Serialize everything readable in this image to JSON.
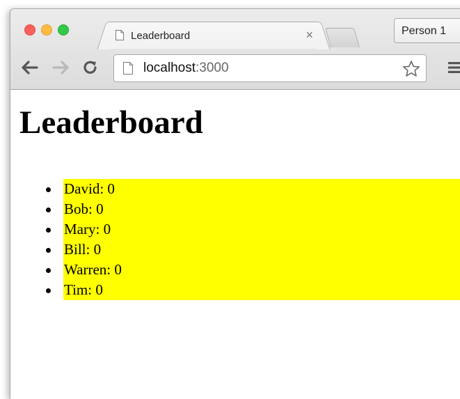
{
  "browser": {
    "tab_title": "Leaderboard",
    "tab_close": "×",
    "profile_button": "Person 1",
    "url_host": "localhost",
    "url_port": ":3000"
  },
  "page": {
    "heading": "Leaderboard",
    "players": [
      {
        "name": "David",
        "score": 0,
        "label": "David: 0"
      },
      {
        "name": "Bob",
        "score": 0,
        "label": "Bob: 0"
      },
      {
        "name": "Mary",
        "score": 0,
        "label": "Mary: 0"
      },
      {
        "name": "Bill",
        "score": 0,
        "label": "Bill: 0"
      },
      {
        "name": "Warren",
        "score": 0,
        "label": "Warren: 0"
      },
      {
        "name": "Tim",
        "score": 0,
        "label": "Tim: 0"
      }
    ]
  },
  "colors": {
    "list_highlight": "#ffff00",
    "close_red": "#fc605b",
    "minimize_yellow": "#fdbc40",
    "zoom_green": "#34c84a"
  },
  "icons": [
    "close-window-icon",
    "minimize-window-icon",
    "zoom-window-icon",
    "page-icon",
    "back-arrow-icon",
    "forward-arrow-icon",
    "reload-icon",
    "star-icon",
    "menu-icon"
  ]
}
